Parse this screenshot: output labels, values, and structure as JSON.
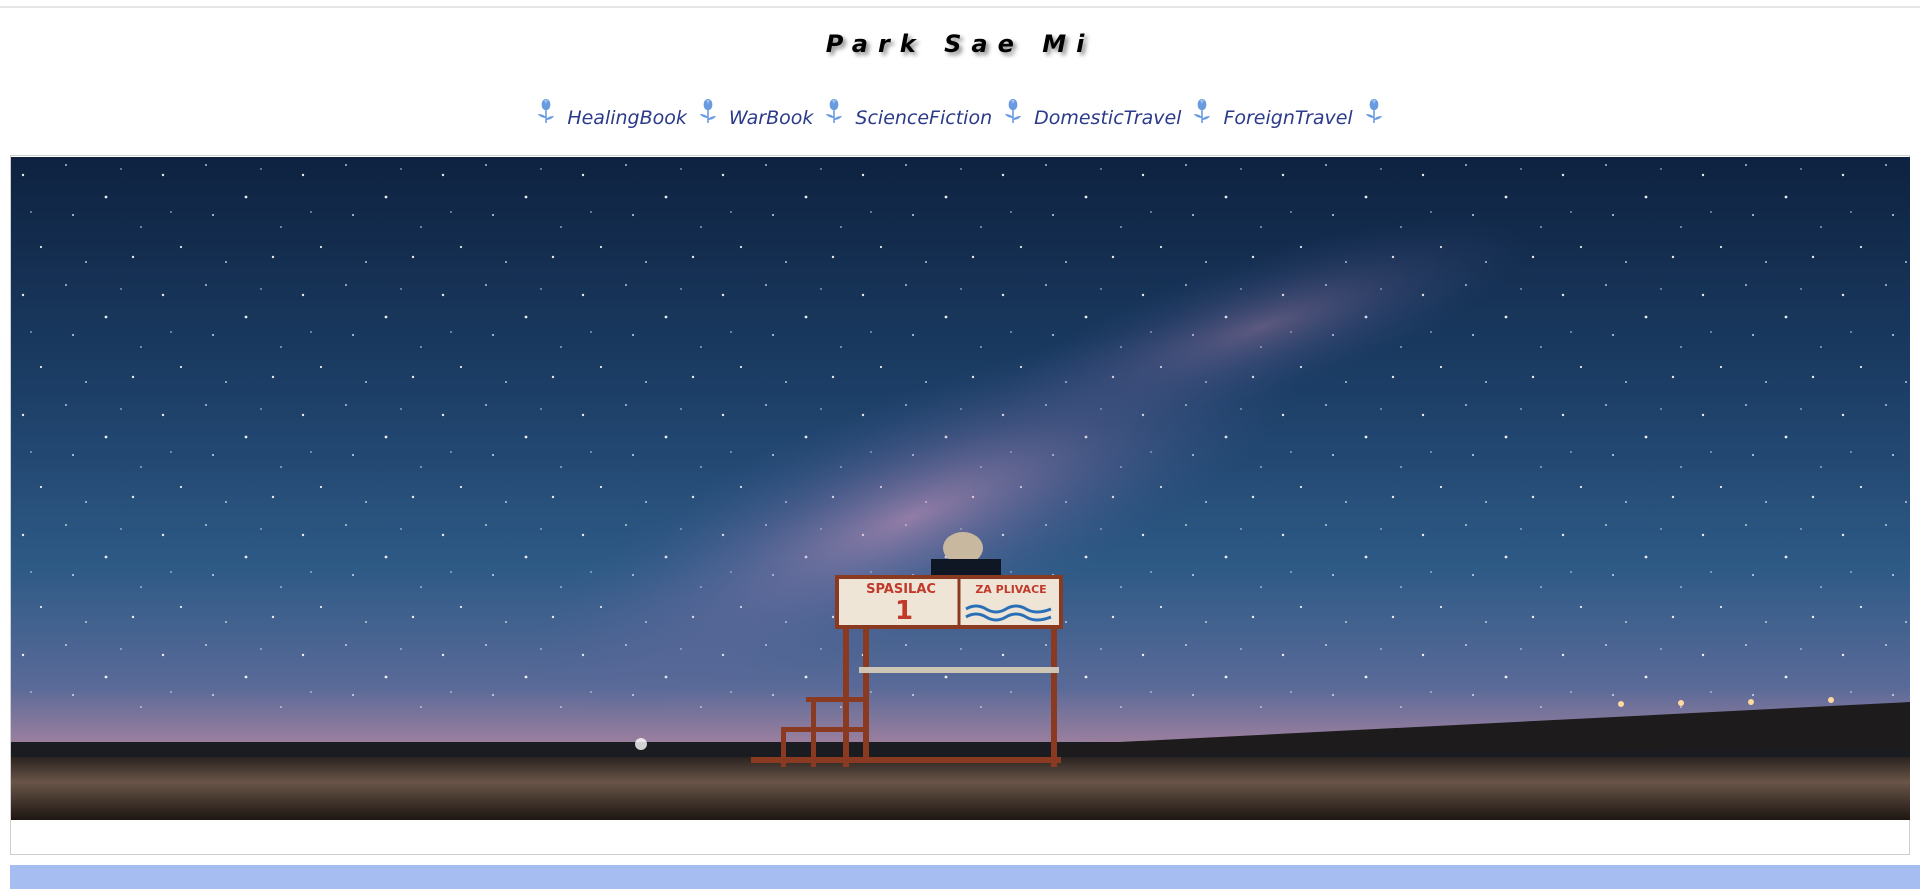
{
  "site": {
    "title": "Park Sae Mi"
  },
  "nav": {
    "items": [
      {
        "label": "HealingBook"
      },
      {
        "label": "WarBook"
      },
      {
        "label": "ScienceFiction"
      },
      {
        "label": "DomesticTravel"
      },
      {
        "label": "ForeignTravel"
      }
    ],
    "icon": "tulip-icon"
  },
  "hero": {
    "image": "night-sky-lifeguard-chair",
    "sign_left_text": "SPASILAC",
    "sign_left_number": "1",
    "sign_right_text": "ZA PLIVACE"
  },
  "colors": {
    "nav_text": "#2b3a8a",
    "tulip": "#6a9be0",
    "bottom_bar": "#a6bdf2"
  }
}
